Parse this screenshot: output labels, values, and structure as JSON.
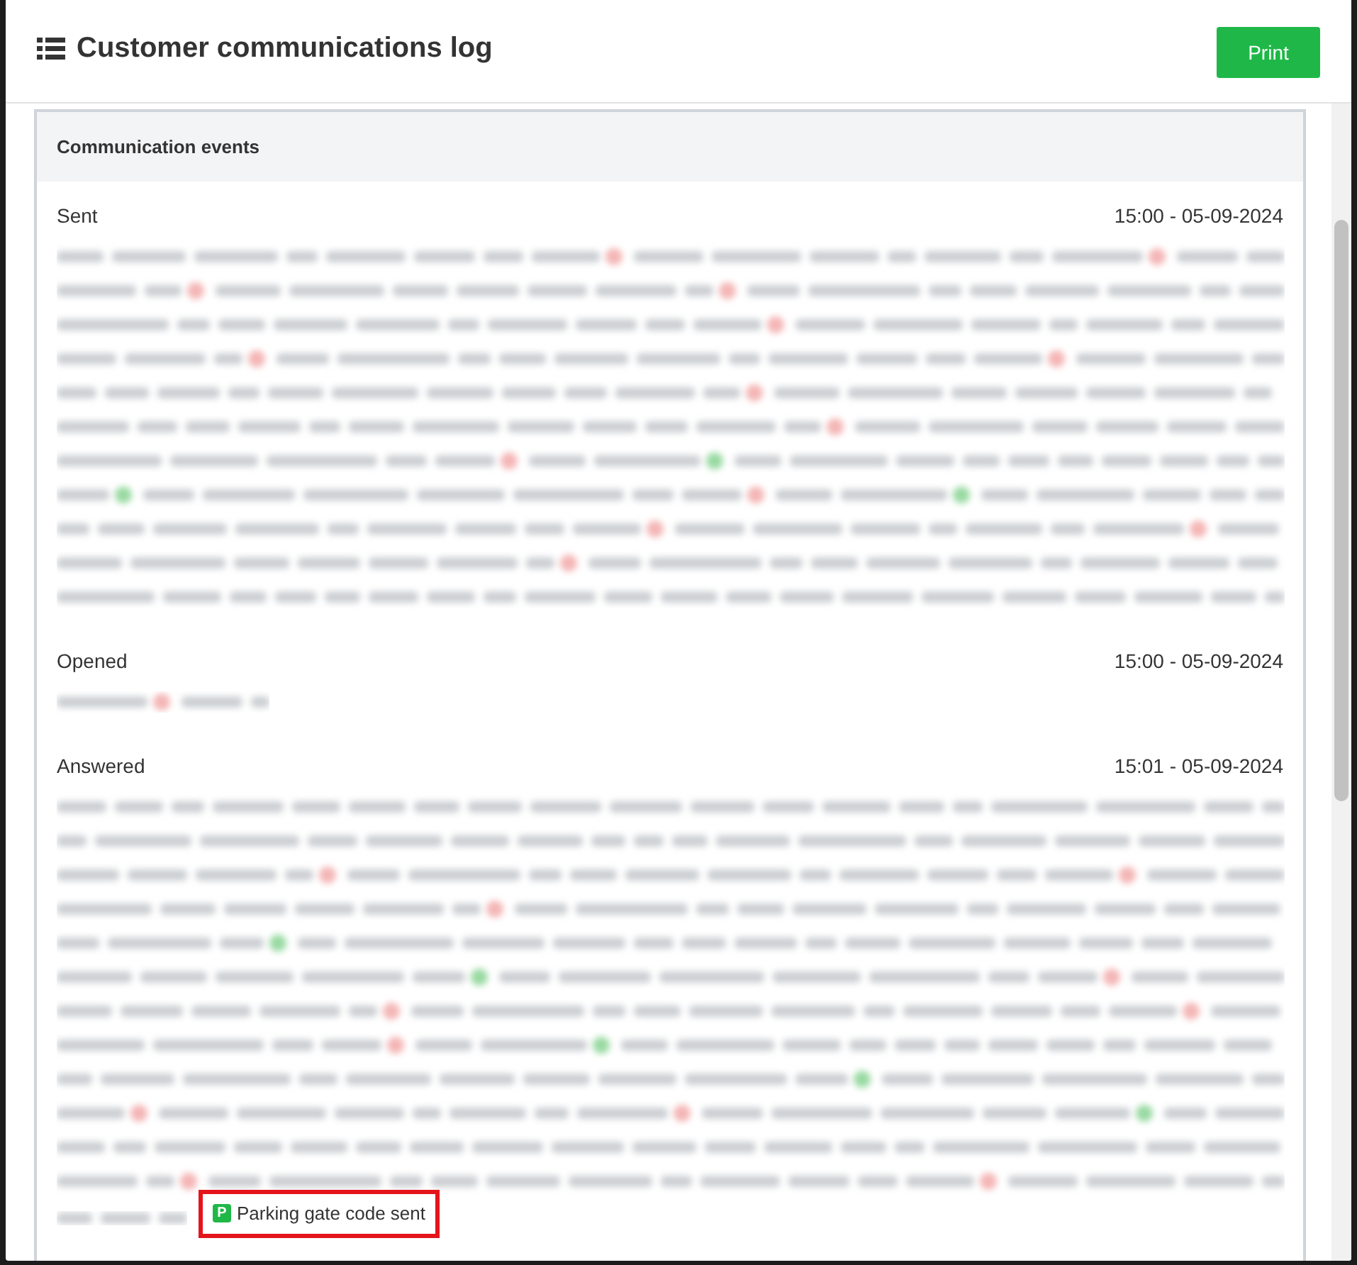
{
  "dialog": {
    "title": "Customer communications log",
    "print_button": "Print"
  },
  "panel": {
    "title": "Communication events",
    "events": [
      {
        "label": "Sent",
        "time": "15:00 - 05-09-2024"
      },
      {
        "label": "Opened",
        "time": "15:00 - 05-09-2024"
      },
      {
        "label": "Answered",
        "time": "15:01 - 05-09-2024",
        "tag": {
          "icon_letter": "P",
          "text": "Parking gate code sent",
          "highlighted": true
        }
      }
    ]
  }
}
